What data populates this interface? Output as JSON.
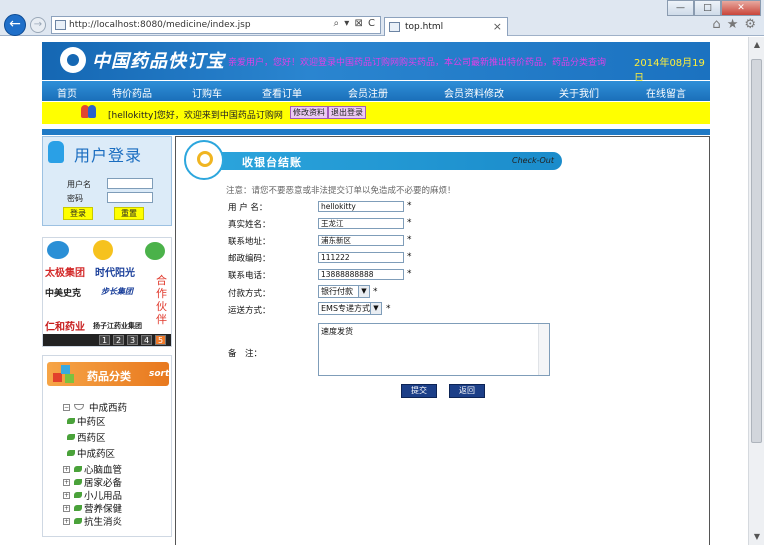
{
  "browser": {
    "url": "http://localhost:8080/medicine/index.jsp",
    "tab_title": "top.html",
    "minimize": "—",
    "maximize": "□",
    "close": "✕",
    "back": "←",
    "forward": "→",
    "addr_icons": "⌕ ▾ ⊠ C",
    "tab_close": "×",
    "home": "⌂",
    "favorites": "★",
    "tools": "⚙"
  },
  "header": {
    "logo_text": "中国药品快订宝",
    "marquee": "亲爱用户，您好！欢迎登录中国药品订购网购买药品，本公司最新推出特价药品，药品分类查询",
    "date": "2014年08月19日"
  },
  "menu": [
    "首页",
    "特价药品",
    "订购车",
    "查看订单",
    "会员注册",
    "会员资料修改",
    "关于我们",
    "在线留言"
  ],
  "welcome": {
    "message": "[hellokitty]您好，欢迎来到中国药品订购网",
    "edit_profile": "修改资料",
    "logout": "退出登录"
  },
  "login": {
    "title": "用户登录",
    "username_label": "用户名",
    "password_label": "密码",
    "login_button": "登录",
    "reset_button": "重置"
  },
  "partners": {
    "names": [
      "太极集团",
      "时代阳光",
      "中美史克",
      "步长集团",
      "仁和药业",
      "扬子江药业集团"
    ],
    "side_text": "合作伙伴",
    "pages": [
      "1",
      "2",
      "3",
      "4",
      "5"
    ],
    "active_page": "5"
  },
  "categories": {
    "title": "药品分类",
    "sort_text": "sort",
    "tree": [
      {
        "label": "中成西药",
        "type": "folder"
      },
      {
        "label": "中药区",
        "type": "sub"
      },
      {
        "label": "西药区",
        "type": "sub"
      },
      {
        "label": "中成药区",
        "type": "sub"
      },
      {
        "label": "心脑血管",
        "type": "node"
      },
      {
        "label": "居家必备",
        "type": "node"
      },
      {
        "label": "小儿用品",
        "type": "node"
      },
      {
        "label": "营养保健",
        "type": "node"
      },
      {
        "label": "抗生消炎",
        "type": "node"
      }
    ]
  },
  "checkout": {
    "title": "收银台结账",
    "subtitle": "Check-Out",
    "notice": "注意：请您不要恶意或非法提交订单以免造成不必要的麻烦！",
    "fields": [
      {
        "label": "用 户 名：",
        "value": "hellokitty"
      },
      {
        "label": "真实姓名：",
        "value": "王龙江"
      },
      {
        "label": "联系地址：",
        "value": "浦东新区"
      },
      {
        "label": "邮政编码：",
        "value": "111222"
      },
      {
        "label": "联系电话：",
        "value": "13888888888"
      }
    ],
    "payment_label": "付款方式：",
    "payment_value": "银行付款",
    "shipping_label": "运送方式：",
    "shipping_value": "EMS专递方式",
    "remark_label": "备　注：",
    "remark_value": "速度发货",
    "required_mark": "*",
    "submit_button": "提交",
    "back_button": "返回"
  }
}
